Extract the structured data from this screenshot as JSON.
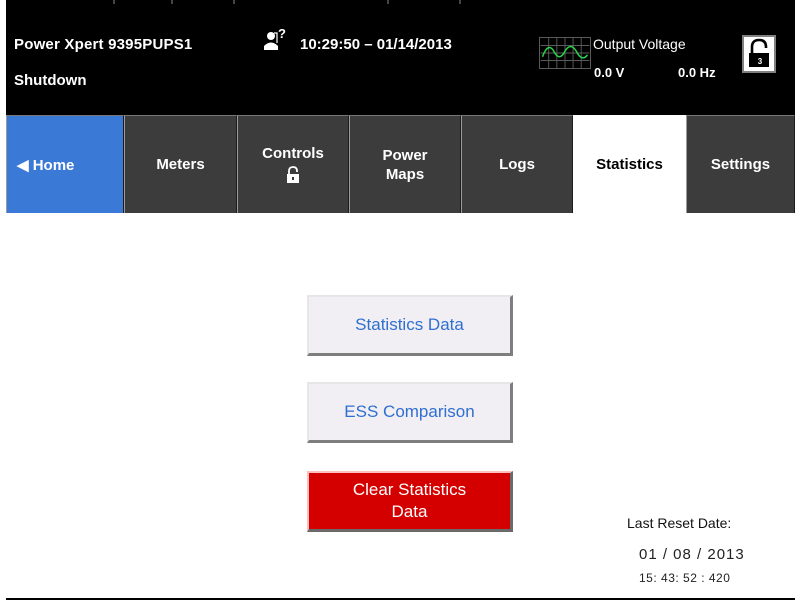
{
  "header": {
    "device_model": "Power Xpert 9395PUPS1",
    "system_status": "Shutdown",
    "user_level_badge": "?",
    "datetime": "10:29:50 – 01/14/2013",
    "output_label": "Output Voltage",
    "output_voltage": "0.0 V",
    "output_frequency": "0.0 Hz",
    "lock_level": "3",
    "icons": [
      "user-icon",
      "waveform-icon",
      "unlocked-padlock-icon"
    ]
  },
  "tabs": [
    {
      "label": "◀ Home"
    },
    {
      "label": "Meters"
    },
    {
      "label": "Controls"
    },
    {
      "label": "Power\nMaps"
    },
    {
      "label": "Logs"
    },
    {
      "label": "Statistics"
    },
    {
      "label": "Settings"
    }
  ],
  "active_tab": "Statistics",
  "content": {
    "statistics_data_button": "Statistics Data",
    "ess_comparison_button": "ESS Comparison",
    "clear_statistics_line1": "Clear Statistics",
    "clear_statistics_line2": "Data",
    "last_reset_label": "Last Reset Date:",
    "last_reset_date": "01 / 08 / 2013",
    "last_reset_time": "15: 43: 52 : 420"
  },
  "colors": {
    "header_bg": "#000000",
    "tab_bg": "#3c3c3c",
    "home_tab": "#3b79d6",
    "button_text": "#2f6fd0",
    "danger": "#d40000"
  }
}
